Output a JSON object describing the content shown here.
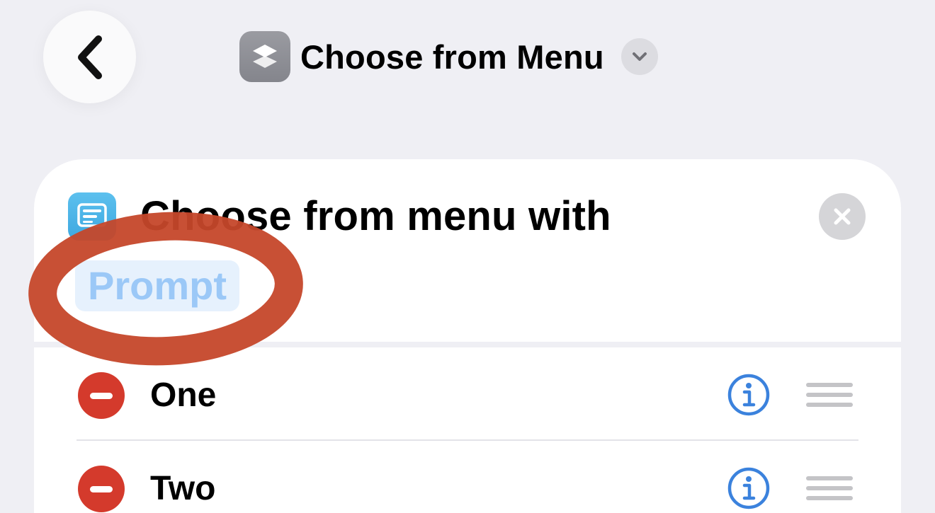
{
  "nav": {
    "back_icon": "chevron-left-icon",
    "app_icon": "layers-icon",
    "title": "Choose from Menu",
    "title_menu_icon": "chevron-down-icon"
  },
  "action": {
    "icon": "menu-list-icon",
    "text": "Choose from menu with",
    "prompt_placeholder": "Prompt",
    "clear_icon": "close-icon"
  },
  "menu_items": [
    {
      "label": "One",
      "delete_icon": "minus-circle-icon",
      "info_icon": "info-icon",
      "reorder_icon": "drag-handle-icon"
    },
    {
      "label": "Two",
      "delete_icon": "minus-circle-icon",
      "info_icon": "info-icon",
      "reorder_icon": "drag-handle-icon"
    }
  ],
  "annotation": {
    "shape": "hand-drawn-ellipse",
    "target": "prompt-token"
  },
  "colors": {
    "background": "#efeff4",
    "card": "#ffffff",
    "accent_blue": "#3b82dd",
    "prompt_token_bg": "#e6f1fd",
    "prompt_token_text": "#9bc8f7",
    "delete_red": "#d43a2c",
    "annotation_red": "#c5472a"
  }
}
